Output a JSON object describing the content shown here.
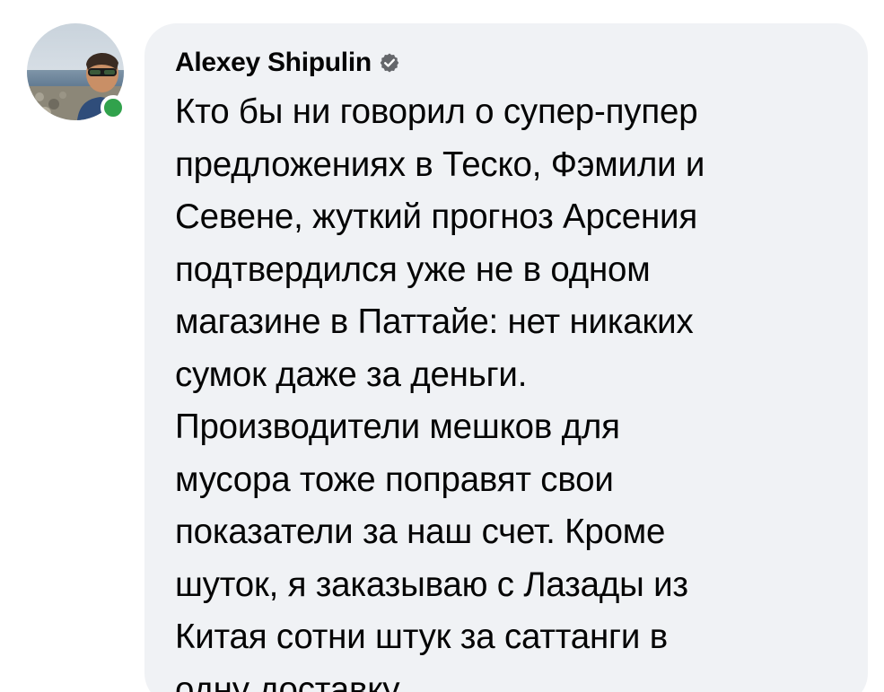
{
  "comment": {
    "author": "Alexey Shipulin",
    "verified": true,
    "online": true,
    "text_lines": [
      "Кто бы ни говорил о супер-пупер",
      "предложениях в Теско, Фэмили и",
      "Севене, жуткий прогноз Арсения",
      "подтвердился уже не в одном",
      "магазине в Паттайе: нет никаких",
      "сумок даже за деньги.",
      "Производители мешков для",
      "мусора тоже поправят свои",
      "показатели за наш счет. Кроме",
      "шуток, я заказываю с Лазады из",
      "Китая сотни штук за саттанги в",
      "одну доставку."
    ]
  },
  "icons": {
    "verified": "verified-badge-icon",
    "online": "online-status-dot"
  },
  "colors": {
    "bubble_background": "#f0f2f5",
    "text": "#050505",
    "online_green": "#31a24c",
    "verified_gray": "#65676b"
  }
}
